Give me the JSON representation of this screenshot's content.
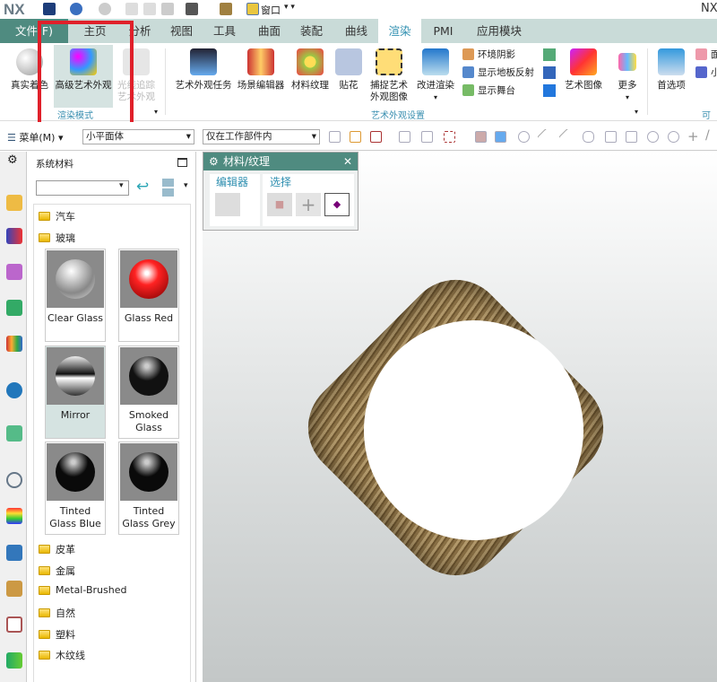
{
  "app": {
    "logo": "NX",
    "title_right": "NX",
    "window_menu": "窗口"
  },
  "tabs": [
    "文件(F)",
    "主页",
    "分析",
    "视图",
    "工具",
    "曲面",
    "装配",
    "曲线",
    "渲染",
    "PMI",
    "应用模块"
  ],
  "active_tab": "渲染",
  "ribbon": {
    "render_mode": {
      "buttons": [
        "真实着色",
        "高级艺术外观",
        "光线追踪艺术外观"
      ],
      "selected": "高级艺术外观",
      "label": "渲染模式"
    },
    "art_settings": {
      "buttons": [
        "艺术外观任务",
        "场景编辑器",
        "材料纹理",
        "贴花",
        "捕捉艺术外观图像",
        "改进渲染"
      ],
      "small": [
        "环境阴影",
        "显示地板反射",
        "显示舞台"
      ],
      "art_image": "艺术图像",
      "more": "更多",
      "label": "艺术外观设置"
    },
    "visual": {
      "preferences": "首选项",
      "small": [
        "面",
        "小"
      ],
      "label": "可视"
    }
  },
  "toolbar": {
    "menu": "菜单(M)",
    "filter": "小平面体",
    "scope": "仅在工作部件内"
  },
  "panel": {
    "title": "系统材料",
    "search_value": "",
    "folders_top": [
      "汽车",
      "玻璃"
    ],
    "materials": [
      {
        "name": "Clear Glass",
        "color": "#cfcfcf"
      },
      {
        "name": "Glass Red",
        "color": "#e21515"
      },
      {
        "name": "Mirror",
        "color": "#222222",
        "selected": true
      },
      {
        "name": "Smoked Glass",
        "color": "#111111"
      },
      {
        "name": "Tinted Glass Blue",
        "color": "#0a0a0a"
      },
      {
        "name": "Tinted Glass Grey",
        "color": "#0a0a0a"
      }
    ],
    "folders_bottom": [
      "皮革",
      "金属",
      "Metal-Brushed",
      "自然",
      "塑料",
      "木纹线"
    ]
  },
  "dialog": {
    "title": "材料/纹理",
    "editor": "编辑器",
    "select": "选择",
    "close": "✕"
  },
  "colors": {
    "accent": "#4f8b80",
    "highlight": "#e0202a",
    "link": "#2f8fb0"
  }
}
